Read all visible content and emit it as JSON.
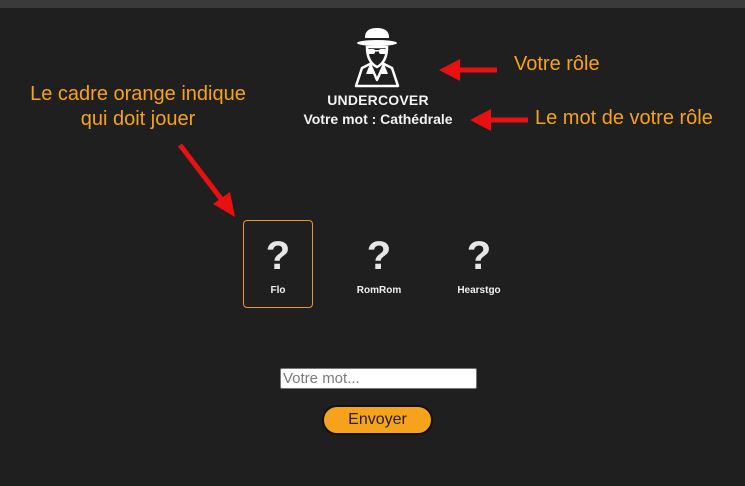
{
  "role": {
    "icon": "spy-icon",
    "name": "UNDERCOVER",
    "word_line": "Votre mot : Cathédrale"
  },
  "annotations": {
    "role": "Votre rôle",
    "word": "Le mot de votre rôle",
    "frame_line1": "Le cadre orange indique",
    "frame_line2": "qui doit jouer"
  },
  "players": [
    {
      "name": "Flo",
      "card": "?",
      "active": true
    },
    {
      "name": "RomRom",
      "card": "?",
      "active": false
    },
    {
      "name": "Hearstgo",
      "card": "?",
      "active": false
    }
  ],
  "form": {
    "placeholder": "Votre mot...",
    "value": "",
    "submit_label": "Envoyer"
  },
  "colors": {
    "background": "#1f1f1f",
    "accent": "#f7a21b",
    "arrow": "#e81010",
    "active_frame": "#e9962a"
  }
}
